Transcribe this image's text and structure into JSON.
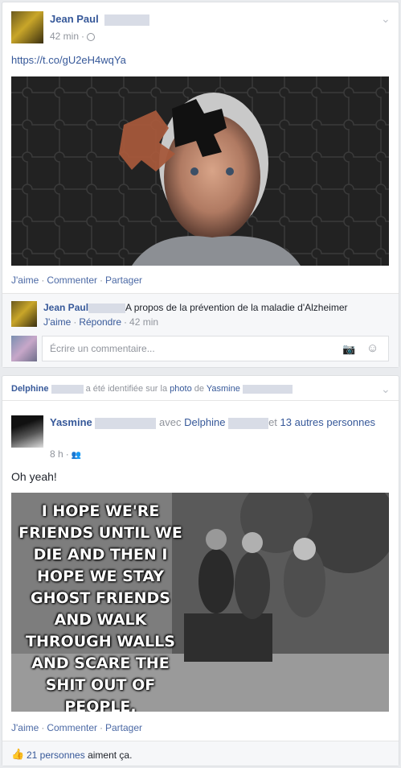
{
  "post1": {
    "author": "Jean Paul",
    "time": "42 min",
    "privacy_icon": "globe-icon",
    "link": "https://t.co/gU2eH4wqYa",
    "actions": [
      "J'aime",
      "Commenter",
      "Partager"
    ],
    "comment": {
      "author": "Jean Paul",
      "text": "A propos de la prévention de la maladie d'Alzheimer",
      "like": "J'aime",
      "reply": "Répondre",
      "time": "42 min"
    },
    "comment_input": {
      "placeholder": "Écrire un commentaire..."
    }
  },
  "post2": {
    "header": {
      "name": "Delphine",
      "middle": "a été identifiée sur la",
      "photo": "photo",
      "de": "de",
      "tagged_name": "Yasmine"
    },
    "author": "Yasmine",
    "with_text": "avec",
    "with_name": "Delphine",
    "and_text": "et",
    "others": "13 autres personnes",
    "time": "8 h",
    "audience_icon": "friends-icon",
    "text": "Oh yeah!",
    "image_text": "I HOPE WE'RE FRIENDS UNTIL WE DIE AND THEN I HOPE WE STAY GHOST FRIENDS AND WALK THROUGH WALLS AND SCARE THE SHIT OUT OF PEOPLE.",
    "actions": [
      "J'aime",
      "Commenter",
      "Partager"
    ],
    "likes": {
      "count": "21 personnes",
      "suffix": "aiment ça."
    }
  }
}
